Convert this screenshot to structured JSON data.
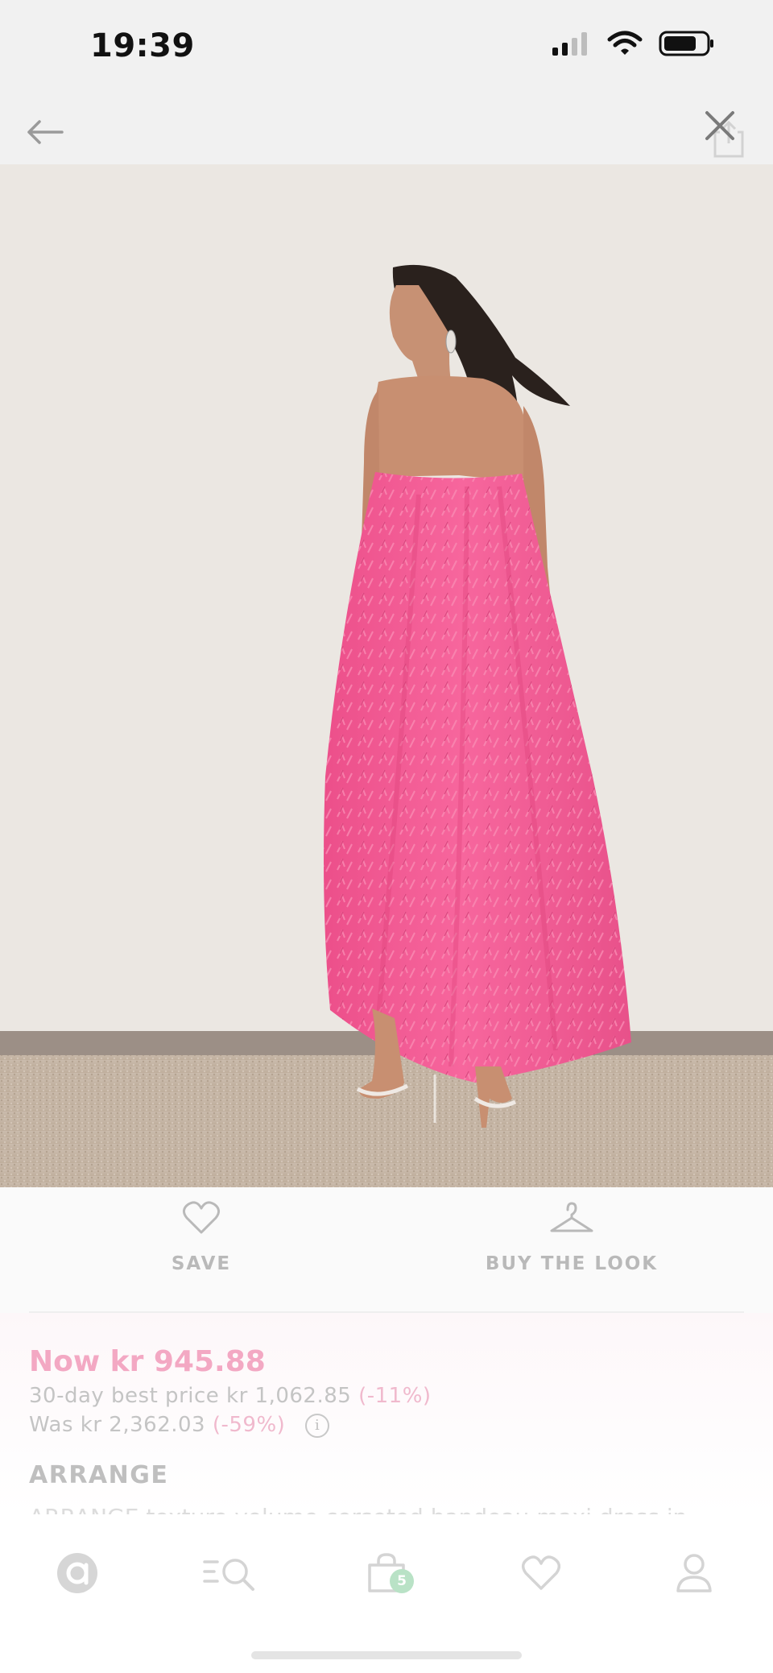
{
  "status_bar": {
    "time": "19:39",
    "icons": [
      "signal-icon",
      "wifi-icon",
      "battery-icon"
    ]
  },
  "nav": {
    "back_icon": "arrow-left-icon",
    "close_icon": "close-icon",
    "share_icon": "share-icon"
  },
  "hero": {
    "image_icon": "product-photo"
  },
  "actions": {
    "save_label": "SAVE",
    "buy_the_look_label": "BUY THE LOOK"
  },
  "product": {
    "price_now": "Now kr 945.88",
    "best_price_text": "30-day best price kr 1,062.85",
    "best_price_pct": "(-11%)",
    "was_text": "Was kr 2,362.03",
    "was_pct": "(-59%)",
    "info_glyph": "i",
    "brand": "ARRANGE",
    "description": "ARRANGE texture volume corseted bandeau maxi dress in"
  },
  "tab_bar": {
    "tabs": [
      "home-icon",
      "search-icon",
      "bag-icon",
      "saved-icon",
      "account-icon"
    ],
    "bag_count": "5"
  },
  "colors": {
    "accent_pink": "#f3a8c3",
    "dress_pink": "#f25c93",
    "badge_green": "#b9e2c6",
    "muted_grey": "#bfbfbf"
  }
}
